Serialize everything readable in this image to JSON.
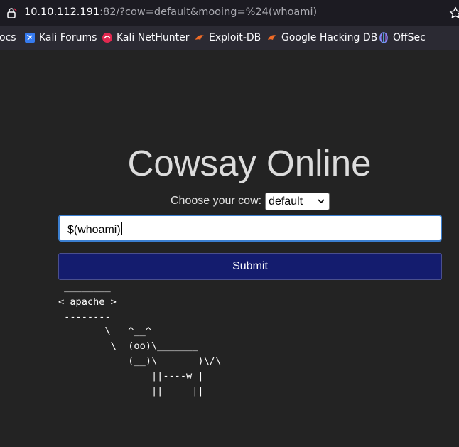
{
  "browser": {
    "url_host": "10.10.112.191",
    "url_rest": ":82/?cow=default&mooing=%24(whoami)",
    "bookmarks": [
      {
        "label": "ocs",
        "icon": "docs"
      },
      {
        "label": "Kali Forums",
        "icon": "kali-forums-icon"
      },
      {
        "label": "Kali NetHunter",
        "icon": "kali-nethunter-icon"
      },
      {
        "label": "Exploit-DB",
        "icon": "exploit-db-icon"
      },
      {
        "label": "Google Hacking DB",
        "icon": "google-hacking-db-icon"
      },
      {
        "label": "OffSec",
        "icon": "offsec-icon"
      }
    ]
  },
  "page": {
    "title": "Cowsay Online",
    "choose_label": "Choose your cow:",
    "cow_selected": "default",
    "input_value": "$(whoami)",
    "submit_label": "Submit",
    "output": " ________\n< apache >\n --------\n        \\   ^__^\n         \\  (oo)\\_______\n            (__)\\       )\\/\\\n                ||----w |\n                ||     ||"
  },
  "colors": {
    "page_bg": "#232323",
    "submit_bg": "#141c6e",
    "input_focus_border": "#3b7fd0"
  }
}
